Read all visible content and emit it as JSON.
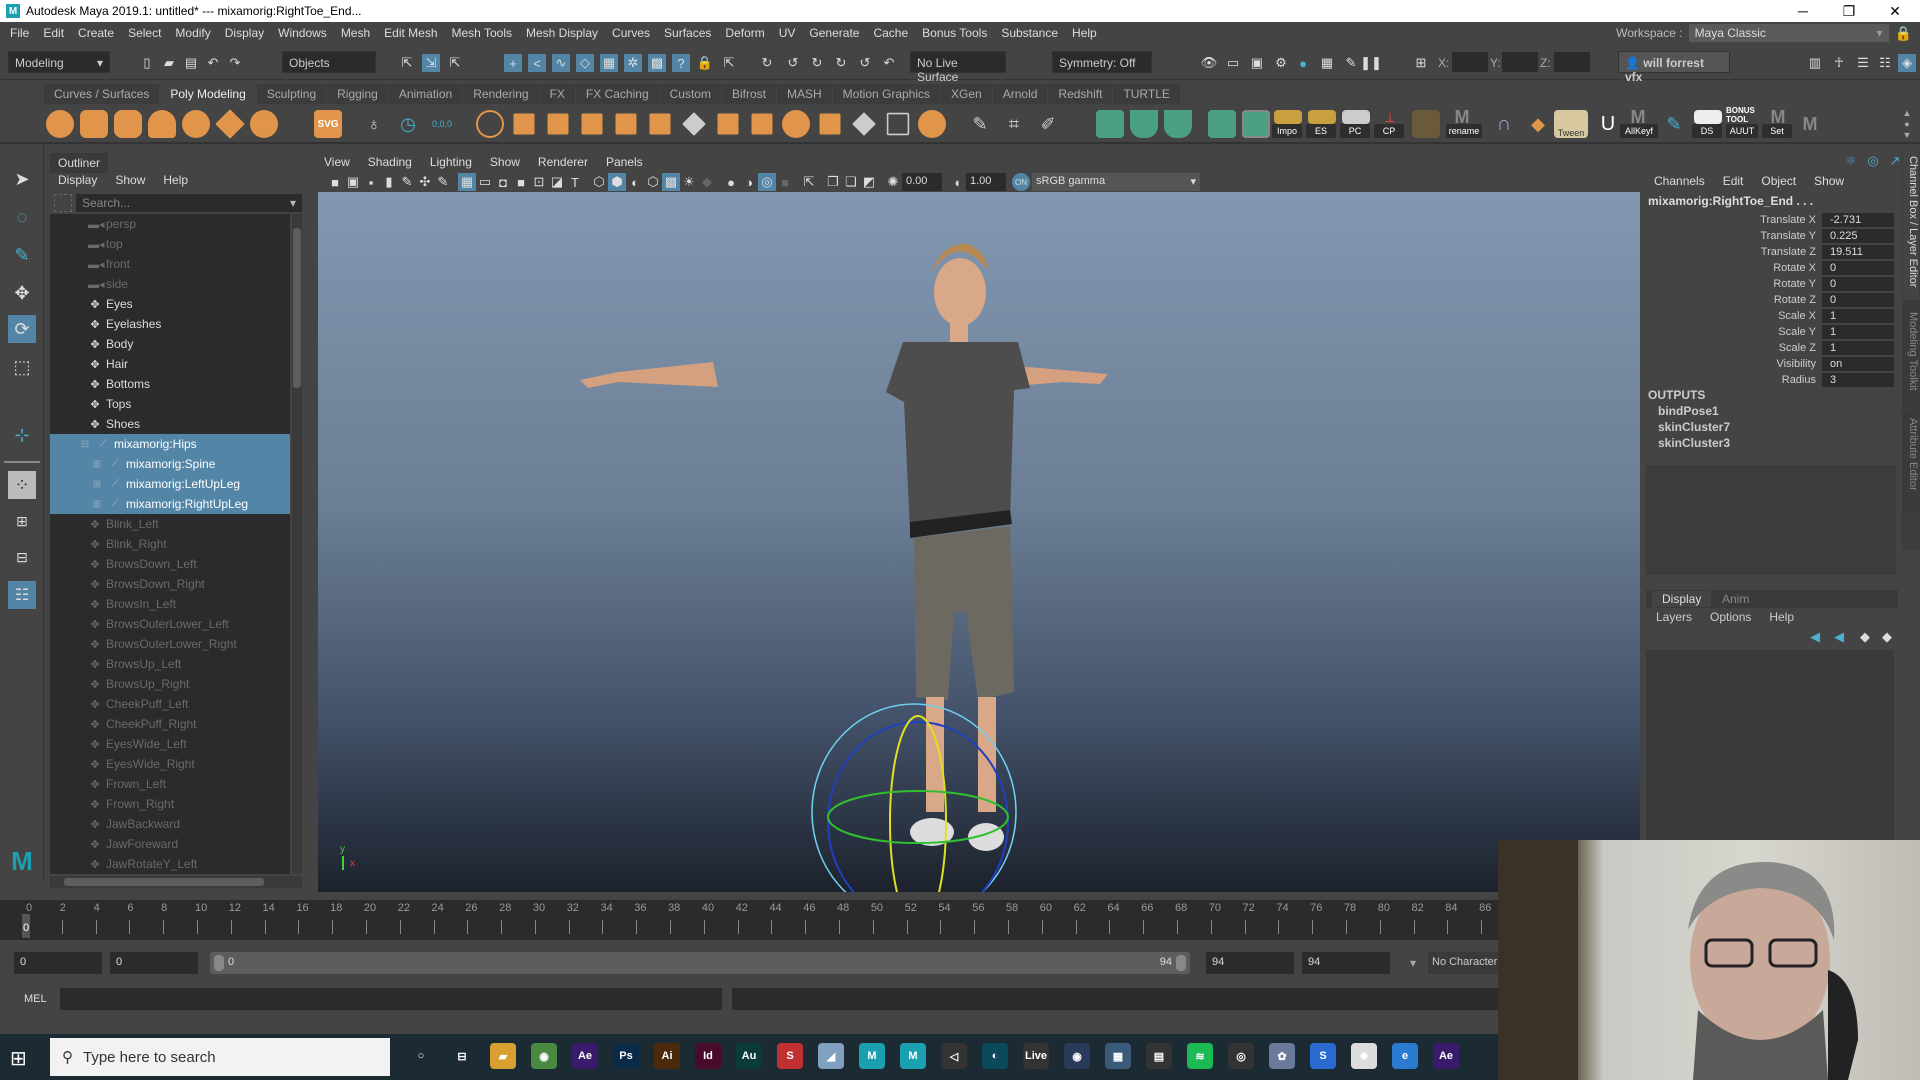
{
  "window": {
    "title": "Autodesk Maya 2019.1: untitled*   ---   mixamorig:RightToe_End...",
    "minimize": "─",
    "maximize": "❐",
    "close": "✕"
  },
  "menubar": [
    "File",
    "Edit",
    "Create",
    "Select",
    "Modify",
    "Display",
    "Windows",
    "Mesh",
    "Edit Mesh",
    "Mesh Tools",
    "Mesh Display",
    "Curves",
    "Surfaces",
    "Deform",
    "UV",
    "Generate",
    "Cache",
    "Bonus Tools",
    "Substance",
    "Help"
  ],
  "workspace": {
    "label": "Workspace :",
    "value": "Maya Classic"
  },
  "statusline": {
    "menuset": "Modeling",
    "select_mode": "Objects",
    "live_surface": "No Live Surface",
    "symmetry": "Symmetry: Off",
    "x_label": "X:",
    "y_label": "Y:",
    "z_label": "Z:",
    "account": "will forrest vfx"
  },
  "shelf": {
    "tabs": [
      "Curves / Surfaces",
      "Poly Modeling",
      "Sculpting",
      "Rigging",
      "Animation",
      "Rendering",
      "FX",
      "FX Caching",
      "Custom",
      "Bifrost",
      "MASH",
      "Motion Graphics",
      "XGen",
      "Arnold",
      "Redshift",
      "TURTLE"
    ],
    "active_tab": "Poly Modeling",
    "labeled_buttons": [
      "Impo",
      "ES",
      "PC",
      "CP",
      "rename",
      "Tween",
      "AllKeyf",
      "DS",
      "AUUT",
      "Set"
    ],
    "svg_label": "SVG",
    "bonus_tool": "BONUS TOOL",
    "coord_label": "0,0,0"
  },
  "outliner": {
    "tab": "Outliner",
    "menu": [
      "Display",
      "Show",
      "Help"
    ],
    "search_placeholder": "Search...",
    "items": [
      {
        "label": "persp",
        "type": "camera",
        "state": "dim"
      },
      {
        "label": "top",
        "type": "camera",
        "state": "dim"
      },
      {
        "label": "front",
        "type": "camera",
        "state": "dim"
      },
      {
        "label": "side",
        "type": "camera",
        "state": "dim"
      },
      {
        "label": "Eyes",
        "type": "transform",
        "state": "normal"
      },
      {
        "label": "Eyelashes",
        "type": "transform",
        "state": "normal"
      },
      {
        "label": "Body",
        "type": "transform",
        "state": "normal"
      },
      {
        "label": "Hair",
        "type": "transform",
        "state": "normal"
      },
      {
        "label": "Bottoms",
        "type": "transform",
        "state": "normal"
      },
      {
        "label": "Tops",
        "type": "transform",
        "state": "normal"
      },
      {
        "label": "Shoes",
        "type": "transform",
        "state": "normal"
      },
      {
        "label": "mixamorig:Hips",
        "type": "joint",
        "state": "selected",
        "indent": 0
      },
      {
        "label": "mixamorig:Spine",
        "type": "joint",
        "state": "selected",
        "indent": 1
      },
      {
        "label": "mixamorig:LeftUpLeg",
        "type": "joint",
        "state": "selected",
        "indent": 1
      },
      {
        "label": "mixamorig:RightUpLeg",
        "type": "joint",
        "state": "selected",
        "indent": 1
      },
      {
        "label": "Blink_Left",
        "type": "transform",
        "state": "dim"
      },
      {
        "label": "Blink_Right",
        "type": "transform",
        "state": "dim"
      },
      {
        "label": "BrowsDown_Left",
        "type": "transform",
        "state": "dim"
      },
      {
        "label": "BrowsDown_Right",
        "type": "transform",
        "state": "dim"
      },
      {
        "label": "BrowsIn_Left",
        "type": "transform",
        "state": "dim"
      },
      {
        "label": "BrowsOuterLower_Left",
        "type": "transform",
        "state": "dim"
      },
      {
        "label": "BrowsOuterLower_Right",
        "type": "transform",
        "state": "dim"
      },
      {
        "label": "BrowsUp_Left",
        "type": "transform",
        "state": "dim"
      },
      {
        "label": "BrowsUp_Right",
        "type": "transform",
        "state": "dim"
      },
      {
        "label": "CheekPuff_Left",
        "type": "transform",
        "state": "dim"
      },
      {
        "label": "CheekPuff_Right",
        "type": "transform",
        "state": "dim"
      },
      {
        "label": "EyesWide_Left",
        "type": "transform",
        "state": "dim"
      },
      {
        "label": "EyesWide_Right",
        "type": "transform",
        "state": "dim"
      },
      {
        "label": "Frown_Left",
        "type": "transform",
        "state": "dim"
      },
      {
        "label": "Frown_Right",
        "type": "transform",
        "state": "dim"
      },
      {
        "label": "JawBackward",
        "type": "transform",
        "state": "dim"
      },
      {
        "label": "JawForeward",
        "type": "transform",
        "state": "dim"
      },
      {
        "label": "JawRotateY_Left",
        "type": "transform",
        "state": "dim"
      }
    ]
  },
  "viewport": {
    "menu": [
      "View",
      "Shading",
      "Lighting",
      "Show",
      "Renderer",
      "Panels"
    ],
    "exposure": "0.00",
    "gamma": "1.00",
    "colorspace": "sRGB gamma",
    "axis_y": "y",
    "axis_x": "x"
  },
  "channelbox": {
    "menu": [
      "Channels",
      "Edit",
      "Object",
      "Show"
    ],
    "node": "mixamorig:RightToe_End . . .",
    "attrs": [
      {
        "name": "Translate X",
        "value": "-2.731"
      },
      {
        "name": "Translate Y",
        "value": "0.225"
      },
      {
        "name": "Translate Z",
        "value": "19.511"
      },
      {
        "name": "Rotate X",
        "value": "0"
      },
      {
        "name": "Rotate Y",
        "value": "0"
      },
      {
        "name": "Rotate Z",
        "value": "0"
      },
      {
        "name": "Scale X",
        "value": "1"
      },
      {
        "name": "Scale Y",
        "value": "1"
      },
      {
        "name": "Scale Z",
        "value": "1"
      },
      {
        "name": "Visibility",
        "value": "on"
      },
      {
        "name": "Radius",
        "value": "3"
      }
    ],
    "outputs_label": "OUTPUTS",
    "outputs": [
      "bindPose1",
      "skinCluster7",
      "skinCluster3"
    ]
  },
  "layer_editor": {
    "tabs": [
      "Display",
      "Anim"
    ],
    "active_tab": "Display",
    "menu": [
      "Layers",
      "Options",
      "Help"
    ]
  },
  "side_tabs": [
    "Channel Box / Layer Editor",
    "Modeling Toolkit",
    "Attribute Editor"
  ],
  "timeline": {
    "ticks": [
      "0",
      "2",
      "4",
      "6",
      "8",
      "10",
      "12",
      "14",
      "16",
      "18",
      "20",
      "22",
      "24",
      "26",
      "28",
      "30",
      "32",
      "34",
      "36",
      "38",
      "40",
      "42",
      "44",
      "46",
      "48",
      "50",
      "52",
      "54",
      "56",
      "58",
      "60",
      "62",
      "64",
      "66",
      "68",
      "70",
      "72",
      "74",
      "76",
      "78",
      "80",
      "82",
      "84",
      "86"
    ],
    "current_frame": "0"
  },
  "range": {
    "start": "0",
    "anim_start": "0",
    "slider_start": "0",
    "slider_end": "94",
    "anim_end": "94",
    "end": "94",
    "character": "No Character"
  },
  "cmdline": {
    "label": "MEL"
  },
  "taskbar": {
    "search_placeholder": "Type here to search",
    "apps": [
      "Cortana",
      "Task View",
      "File Explorer",
      "Chrome",
      "After Effects",
      "Photoshop",
      "Illustrator",
      "InDesign",
      "Audition",
      "Substance",
      "Notes",
      "Maya",
      "Maya",
      "Unity",
      "Cinema",
      "Live",
      "Cinema 4D",
      "Calculator",
      "Clapper",
      "Spotify",
      "OBS",
      "Blender",
      "Substance Painter",
      "ZBrush",
      "Edge",
      "After Effects"
    ]
  }
}
